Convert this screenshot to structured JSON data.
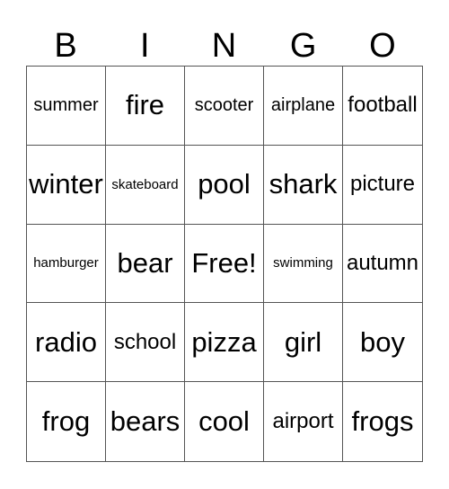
{
  "header": {
    "letters": [
      "B",
      "I",
      "N",
      "G",
      "O"
    ]
  },
  "grid": {
    "rows": [
      [
        {
          "text": "summer",
          "size": "s18"
        },
        {
          "text": "fire",
          "size": "s30"
        },
        {
          "text": "scooter",
          "size": "s18"
        },
        {
          "text": "airplane",
          "size": "s18"
        },
        {
          "text": "football",
          "size": "s22"
        }
      ],
      [
        {
          "text": "winter",
          "size": "s30"
        },
        {
          "text": "skateboard",
          "size": "s15"
        },
        {
          "text": "pool",
          "size": "s30"
        },
        {
          "text": "shark",
          "size": "s30"
        },
        {
          "text": "picture",
          "size": "s22"
        }
      ],
      [
        {
          "text": "hamburger",
          "size": "s15"
        },
        {
          "text": "bear",
          "size": "s30"
        },
        {
          "text": "Free!",
          "size": "s30"
        },
        {
          "text": "swimming",
          "size": "s15"
        },
        {
          "text": "autumn",
          "size": "s22"
        }
      ],
      [
        {
          "text": "radio",
          "size": "s30"
        },
        {
          "text": "school",
          "size": "s22"
        },
        {
          "text": "pizza",
          "size": "s30"
        },
        {
          "text": "girl",
          "size": "s30"
        },
        {
          "text": "boy",
          "size": "s30"
        }
      ],
      [
        {
          "text": "frog",
          "size": "s30"
        },
        {
          "text": "bears",
          "size": "s30"
        },
        {
          "text": "cool",
          "size": "s30"
        },
        {
          "text": "airport",
          "size": "s22"
        },
        {
          "text": "frogs",
          "size": "s30"
        }
      ]
    ]
  }
}
